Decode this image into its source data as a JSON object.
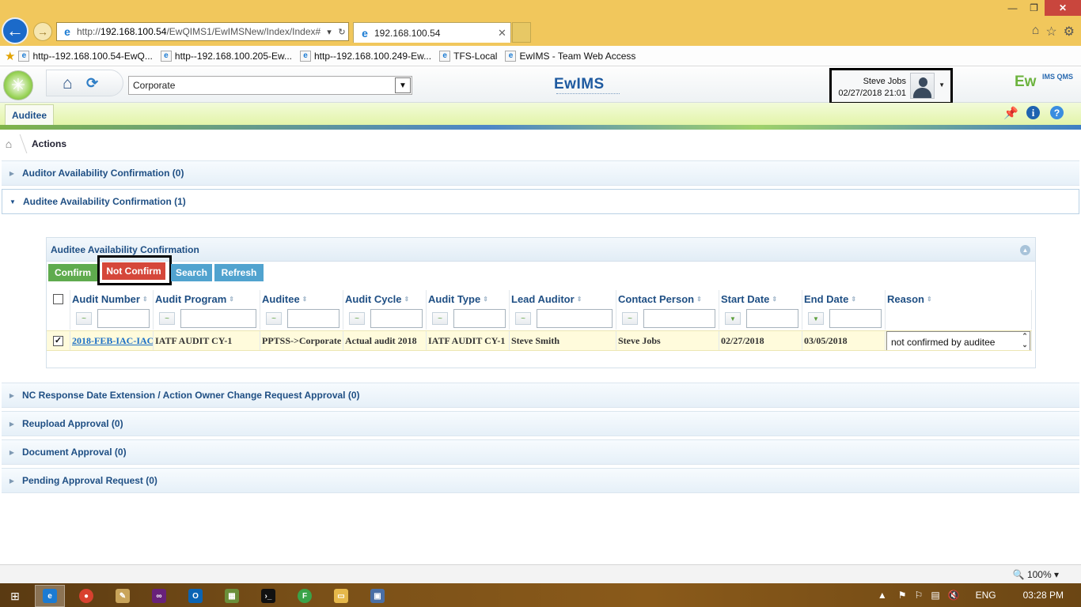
{
  "browser": {
    "url_prefix": "http://",
    "url_host": "192.168.100.54",
    "url_path": "/EwQIMS1/EwIMSNew/Index/Index#",
    "tab_title": "192.168.100.54",
    "favorites": [
      "http--192.168.100.54-EwQ...",
      "http--192.168.100.205-Ew...",
      "http--192.168.100.249-Ew...",
      "TFS-Local",
      "EwIMS - Team Web Access"
    ],
    "zoom": "100%"
  },
  "header": {
    "org_select_value": "Corporate",
    "center_logo": "EwIMS",
    "brand_logo": "Ew",
    "brand_sup": "IMS QMS",
    "user_name": "Steve Jobs",
    "user_datetime": "02/27/2018 21:01"
  },
  "module_tab": "Auditee",
  "breadcrumb": "Actions",
  "sections": {
    "auditor": "Auditor Availability Confirmation (0)",
    "auditee": "Auditee Availability Confirmation (1)",
    "nc_response": "NC Response Date Extension / Action Owner Change Request Approval (0)",
    "reupload": "Reupload Approval (0)",
    "document": "Document Approval (0)",
    "pending": "Pending Approval Request (0)"
  },
  "grid": {
    "title": "Auditee Availability Confirmation",
    "buttons": {
      "confirm": "Confirm",
      "not_confirm": "Not Confirm",
      "search": "Search",
      "refresh": "Refresh"
    },
    "columns": [
      "Audit Number",
      "Audit Program",
      "Auditee",
      "Audit Cycle",
      "Audit Type",
      "Lead Auditor",
      "Contact Person",
      "Start Date",
      "End Date",
      "Reason"
    ],
    "row": {
      "audit_number": "2018-FEB-IAC-IAC",
      "audit_program": "IATF AUDIT CY-1",
      "auditee": "PPTSS->Corporate",
      "audit_cycle": "Actual audit 2018",
      "audit_type": "IATF AUDIT CY-1",
      "lead_auditor": "Steve Smith",
      "contact_person": "Steve Jobs",
      "start_date": "02/27/2018",
      "end_date": "03/05/2018",
      "reason": "not confirmed by auditee"
    }
  },
  "taskbar": {
    "language": "ENG",
    "time": "03:28 PM"
  },
  "colors": {
    "accent_blue": "#1f4f84",
    "confirm_green": "#5fab4e",
    "not_confirm_red": "#d5473a",
    "action_blue": "#51a3cf",
    "selected_row": "#fffbdc"
  }
}
